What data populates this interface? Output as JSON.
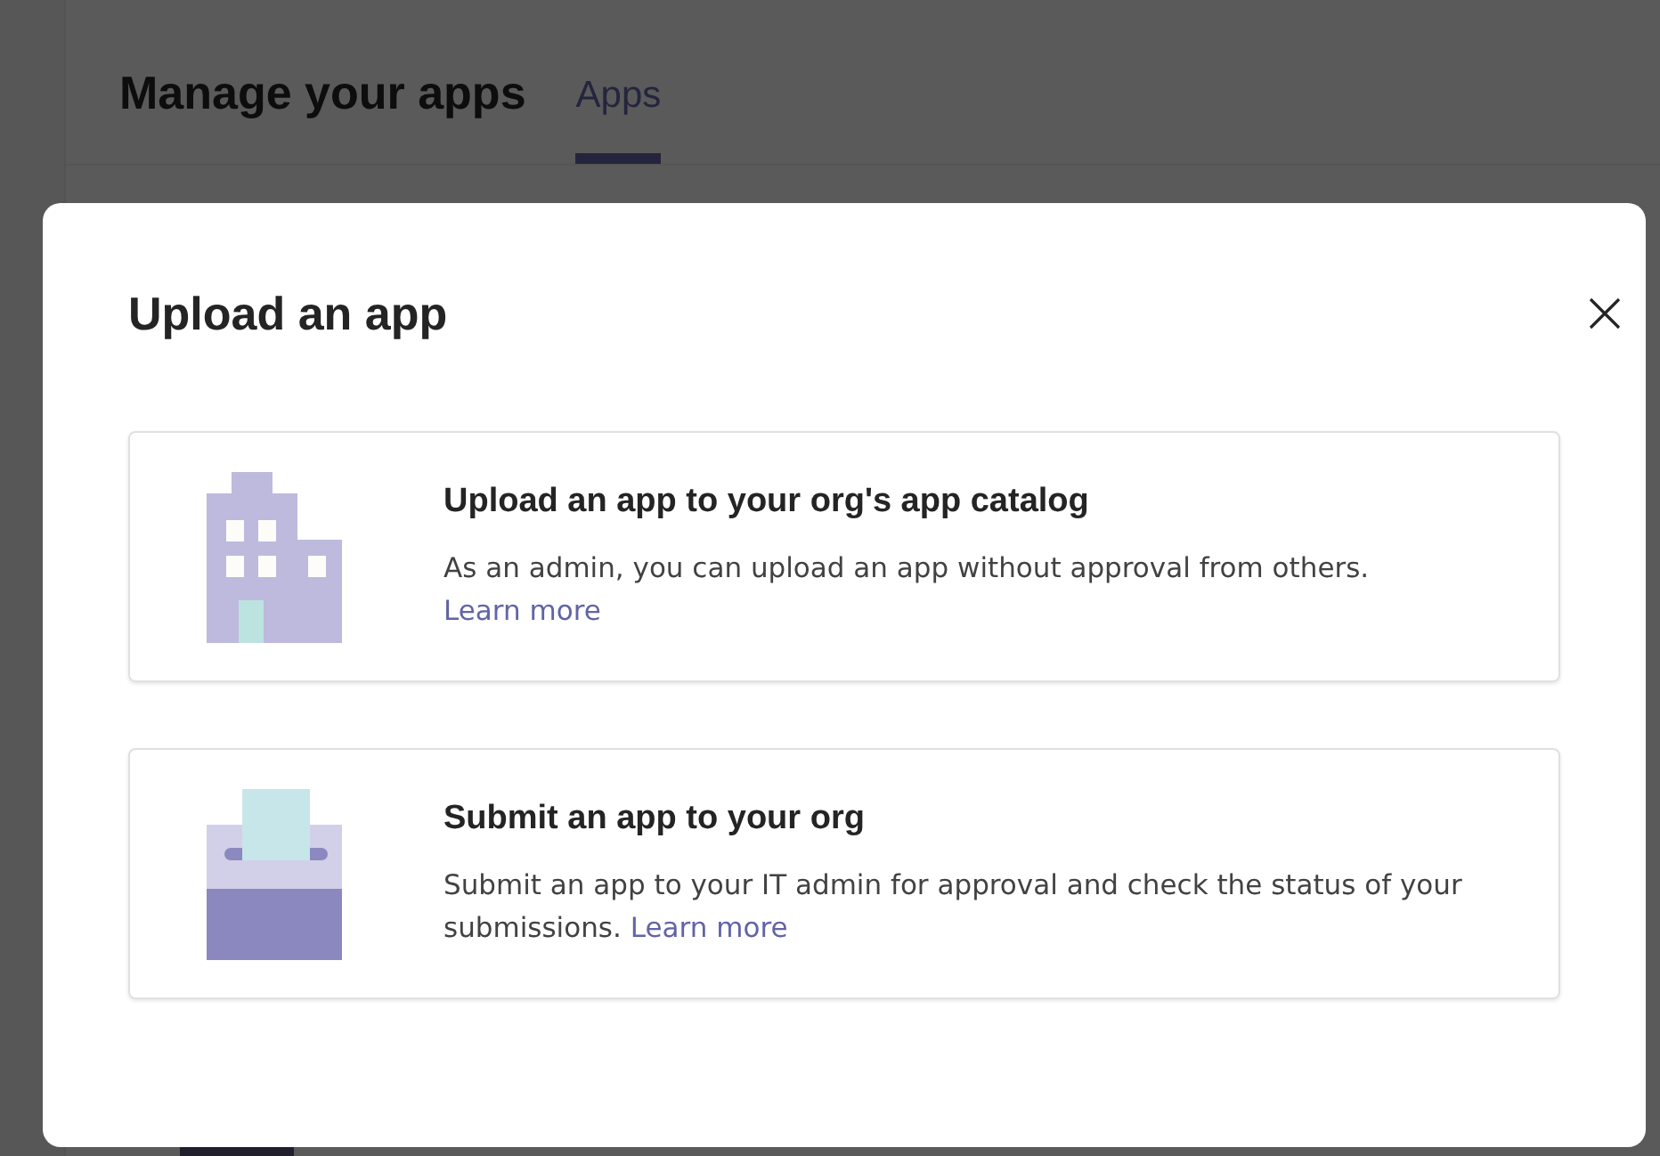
{
  "background": {
    "title": "Manage your apps",
    "tabs": [
      {
        "label": "Apps",
        "selected": true
      }
    ]
  },
  "dialog": {
    "title": "Upload an app",
    "options": [
      {
        "kind": "building",
        "title": "Upload an app to your org's app catalog",
        "description": "As an admin, you can upload an app without approval from others.",
        "link": "Learn more"
      },
      {
        "kind": "ballot-box",
        "title": "Submit an app to your org",
        "description": "Submit an app to your IT admin for approval and check the status of your submissions.",
        "link": "Learn more"
      }
    ]
  }
}
